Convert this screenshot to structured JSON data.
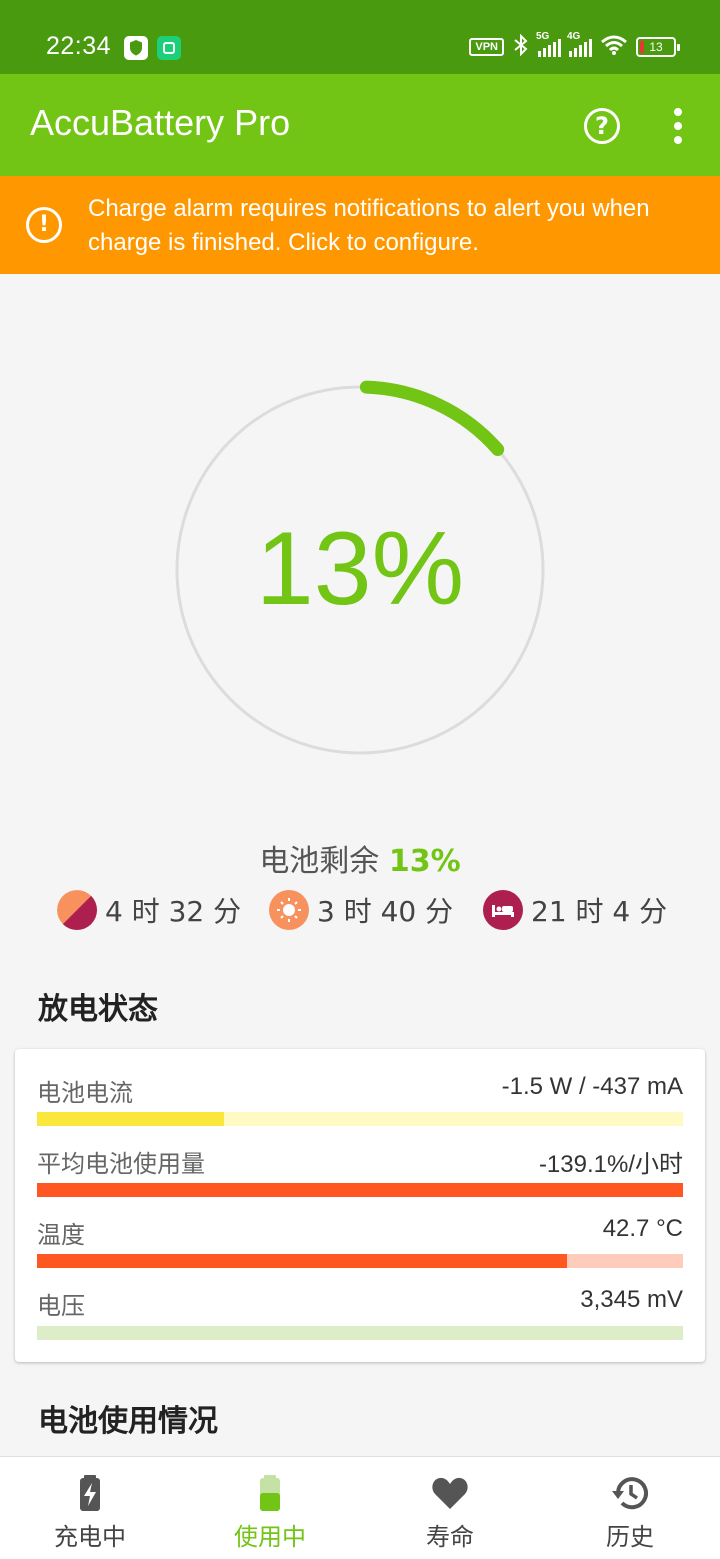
{
  "status_bar": {
    "time": "22:34",
    "vpn": "VPN",
    "net1": "5G",
    "net2": "4G",
    "battery": "13"
  },
  "app_bar": {
    "title": "AccuBattery Pro",
    "help_icon": "help-circle-icon",
    "menu_icon": "more-vert-icon"
  },
  "alert": {
    "icon": "warning-circle-icon",
    "message": "Charge alarm requires notifications to alert you when charge is finished. Click to configure."
  },
  "gauge": {
    "percent_text": "13%",
    "level": 0.13
  },
  "remaining": {
    "label": "电池剩余",
    "percent": "13%"
  },
  "estimates": [
    {
      "icon": "mixed-usage-icon",
      "value": "4 时 32 分"
    },
    {
      "icon": "screen-on-icon",
      "value": "3 时 40 分"
    },
    {
      "icon": "sleep-icon",
      "value": "21 时 4 分"
    }
  ],
  "discharge": {
    "heading": "放电状态",
    "rows": [
      {
        "label": "电池电流",
        "value": "-1.5 W / -437 mA",
        "level": 0.29,
        "color": "#fbe63b",
        "track": "#fff9c4"
      },
      {
        "label": "平均电池使用量",
        "value": "-139.1%/小时",
        "level": 1.0,
        "color": "#ff5722",
        "track": "#ffccbc"
      },
      {
        "label": "温度",
        "value": "42.7 °C",
        "level": 0.82,
        "color": "#ff5722",
        "track": "#ffccbc"
      },
      {
        "label": "电压",
        "value": "3,345 mV",
        "level": 0.0,
        "color": "#8bc34a",
        "track": "#dcedc8"
      }
    ]
  },
  "usage": {
    "heading": "电池使用情况"
  },
  "nav": [
    {
      "label": "充电中",
      "icon": "battery-charging-icon"
    },
    {
      "label": "使用中",
      "icon": "battery-discharging-icon",
      "active": true
    },
    {
      "label": "寿命",
      "icon": "heart-icon"
    },
    {
      "label": "历史",
      "icon": "history-icon"
    }
  ],
  "colors": {
    "status_bar": "#4a9a10",
    "app_bar": "#72c415",
    "alert": "#ff9800",
    "accent": "#72c415"
  }
}
